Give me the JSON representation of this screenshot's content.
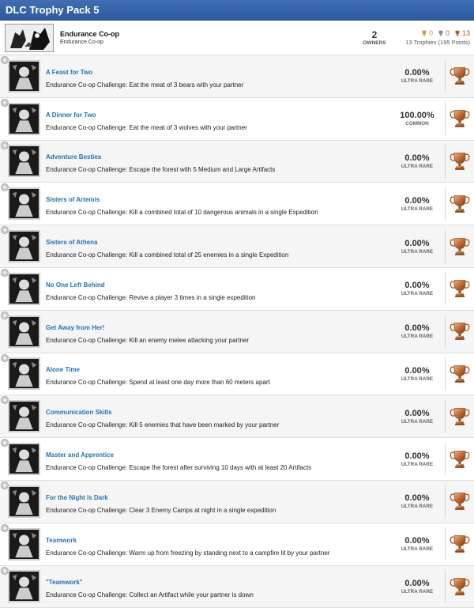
{
  "title": "DLC Trophy Pack 5",
  "pack": {
    "name": "Endurance Co-op",
    "subtitle": "Endurance Co-op",
    "owners": "2",
    "owners_label": "OWNERS",
    "gold": "0",
    "silver": "0",
    "bronze": "13",
    "total": "13 Trophies (195 Points)"
  },
  "colors": {
    "link": "#2472b8",
    "header_blue": "#2d5a9c",
    "bronze": "#c06a34"
  },
  "trophies": [
    {
      "name": "A Feast for Two",
      "desc": "Endurance Co-op Challenge: Eat the meat of 3 bears with your partner",
      "pct": "0.00%",
      "rarity": "ULTRA RARE",
      "icon": "bear-feast-icon"
    },
    {
      "name": "A Dinner for Two",
      "desc": "Endurance Co-op Challenge: Eat the meat of 3 wolves with your partner",
      "pct": "100.00%",
      "rarity": "COMMON",
      "icon": "wolf-dinner-icon"
    },
    {
      "name": "Adventure Besties",
      "desc": "Endurance Co-op Challenge: Escape the forest with 5 Medium and Large Artifacts",
      "pct": "0.00%",
      "rarity": "ULTRA RARE",
      "icon": "artifact-mask-icon"
    },
    {
      "name": "Sisters of Artemis",
      "desc": "Endurance Co-op Challenge: Kill a combined total of 10 dangerous animals in a single Expedition",
      "pct": "0.00%",
      "rarity": "ULTRA RARE",
      "icon": "huntress-icon"
    },
    {
      "name": "Sisters of Athena",
      "desc": "Endurance Co-op Challenge: Kill a combined total of 25 enemies in a single Expedition",
      "pct": "0.00%",
      "rarity": "ULTRA RARE",
      "icon": "warrior-helmet-icon"
    },
    {
      "name": "No One Left Behind",
      "desc": "Endurance Co-op Challenge: Revive a player 3 times in a single expedition",
      "pct": "0.00%",
      "rarity": "ULTRA RARE",
      "icon": "revive-cross-icon"
    },
    {
      "name": "Get Away from Her!",
      "desc": "Endurance Co-op Challenge: Kill an enemy melee attacking your partner",
      "pct": "0.00%",
      "rarity": "ULTRA RARE",
      "icon": "melee-fight-icon"
    },
    {
      "name": "Alone Time",
      "desc": "Endurance Co-op Challenge: Spend at least one day more than 60 meters apart",
      "pct": "0.00%",
      "rarity": "ULTRA RARE",
      "icon": "hourglass-24h-icon"
    },
    {
      "name": "Communication Skills",
      "desc": "Endurance Co-op Challenge: Kill 5 enemies that have been marked by your partner",
      "pct": "0.00%",
      "rarity": "ULTRA RARE",
      "icon": "target-mark-icon"
    },
    {
      "name": "Master and Apprentice",
      "desc": "Endurance Co-op Challenge: Escape the forest after surviving 10 days with at least 20 Artifacts",
      "pct": "0.00%",
      "rarity": "ULTRA RARE",
      "icon": "master-apprentice-icon"
    },
    {
      "name": "For the Night is Dark",
      "desc": "Endurance Co-op Challenge: Clear 3 Enemy Camps at night in a single expedition",
      "pct": "0.00%",
      "rarity": "ULTRA RARE",
      "icon": "campfire-night-icon"
    },
    {
      "name": "Teamwork",
      "desc": "Endurance Co-op Challenge: Warm up from freezing by standing next to a campfire lit by your partner",
      "pct": "0.00%",
      "rarity": "ULTRA RARE",
      "icon": "campfire-warmup-icon"
    },
    {
      "name": "\"Teamwork\"",
      "desc": "Endurance Co-op Challenge: Collect an Artifact while your partner is down",
      "pct": "0.00%",
      "rarity": "ULTRA RARE",
      "icon": "downed-partner-icon"
    }
  ]
}
